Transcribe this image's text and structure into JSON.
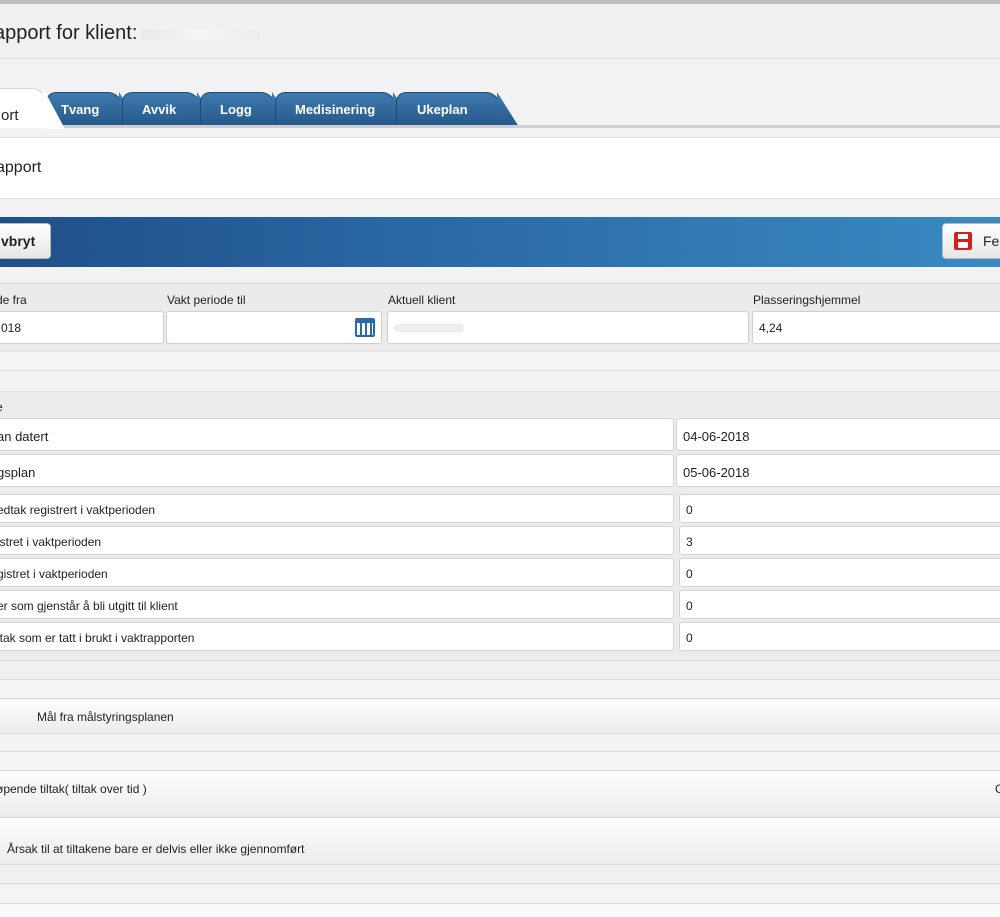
{
  "header": {
    "title": "apport for klient:"
  },
  "tabs": [
    {
      "label": "ort"
    },
    {
      "label": "Tvang"
    },
    {
      "label": "Avvik"
    },
    {
      "label": "Logg"
    },
    {
      "label": "Medisinering"
    },
    {
      "label": "Ukeplan"
    }
  ],
  "subtitle": "apport",
  "toolbar": {
    "cancel_label": "vbryt",
    "save_label": "Fe"
  },
  "fields": {
    "period_from": {
      "label": "de fra",
      "value": "018"
    },
    "period_to": {
      "label": "Vakt periode til",
      "value": ""
    },
    "client": {
      "label": "Aktuell klient",
      "value": ""
    },
    "placement": {
      "label": "Plasseringshjemmel",
      "value": "4,24"
    }
  },
  "section_label": "e",
  "rows": [
    {
      "label": "an datert",
      "value": "04-06-2018"
    },
    {
      "label": "gsplan",
      "value": "05-06-2018"
    },
    {
      "label": "edtak registrert i vaktperioden",
      "value": "0"
    },
    {
      "label": "istret i vaktperioden",
      "value": "3"
    },
    {
      "label": "gistret i vaktperioden",
      "value": "0"
    },
    {
      "label": "er som gjenstår å bli utgitt til klient",
      "value": "0"
    },
    {
      "label": "ltak som er tatt i brukt i vaktrapporten",
      "value": "0"
    }
  ],
  "collapsibles": {
    "goals": "Mål fra målstyringsplanen",
    "ongoing": "øpende tiltak( tiltak over tid )",
    "ongoing_right": "G",
    "reason": "Årsak til at tiltakene bare er delvis eller ikke gjennomført"
  }
}
